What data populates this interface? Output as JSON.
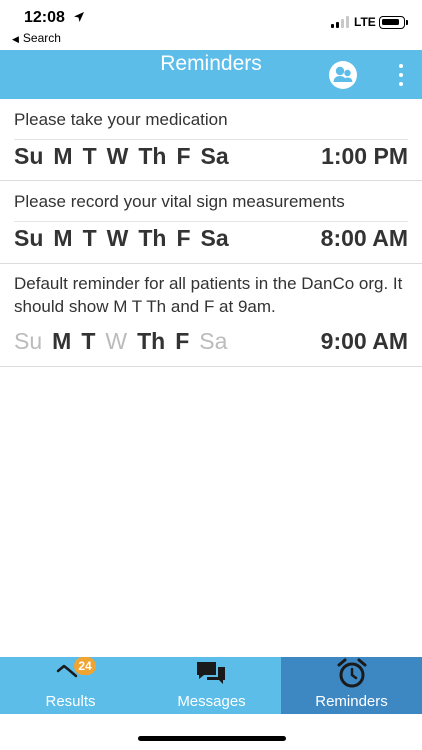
{
  "status": {
    "time": "12:08",
    "back_label": "Search",
    "network": "LTE"
  },
  "header": {
    "title": "Reminders"
  },
  "reminders": [
    {
      "text": "Please take your medication",
      "days": [
        {
          "label": "Su",
          "active": true
        },
        {
          "label": "M",
          "active": true
        },
        {
          "label": "T",
          "active": true
        },
        {
          "label": "W",
          "active": true
        },
        {
          "label": "Th",
          "active": true
        },
        {
          "label": "F",
          "active": true
        },
        {
          "label": "Sa",
          "active": true
        }
      ],
      "time": "1:00 PM"
    },
    {
      "text": "Please record your vital sign measurements",
      "days": [
        {
          "label": "Su",
          "active": true
        },
        {
          "label": "M",
          "active": true
        },
        {
          "label": "T",
          "active": true
        },
        {
          "label": "W",
          "active": true
        },
        {
          "label": "Th",
          "active": true
        },
        {
          "label": "F",
          "active": true
        },
        {
          "label": "Sa",
          "active": true
        }
      ],
      "time": "8:00 AM"
    },
    {
      "text": "Default reminder for all patients in the DanCo org. It should show M T Th and F at 9am.",
      "days": [
        {
          "label": "Su",
          "active": false
        },
        {
          "label": "M",
          "active": true
        },
        {
          "label": "T",
          "active": true
        },
        {
          "label": "W",
          "active": false
        },
        {
          "label": "Th",
          "active": true
        },
        {
          "label": "F",
          "active": true
        },
        {
          "label": "Sa",
          "active": false
        }
      ],
      "time": "9:00 AM"
    }
  ],
  "tabs": [
    {
      "label": "Results",
      "icon": "results-chart-icon",
      "badge": "24",
      "active": false
    },
    {
      "label": "Messages",
      "icon": "chat-bubbles-icon",
      "active": false
    },
    {
      "label": "Reminders",
      "icon": "alarm-clock-icon",
      "active": true
    }
  ],
  "colors": {
    "primary": "#5bbde8",
    "active_tab": "#3d87c2",
    "badge": "#f0a431",
    "inactive_day": "#bbbbbb"
  }
}
